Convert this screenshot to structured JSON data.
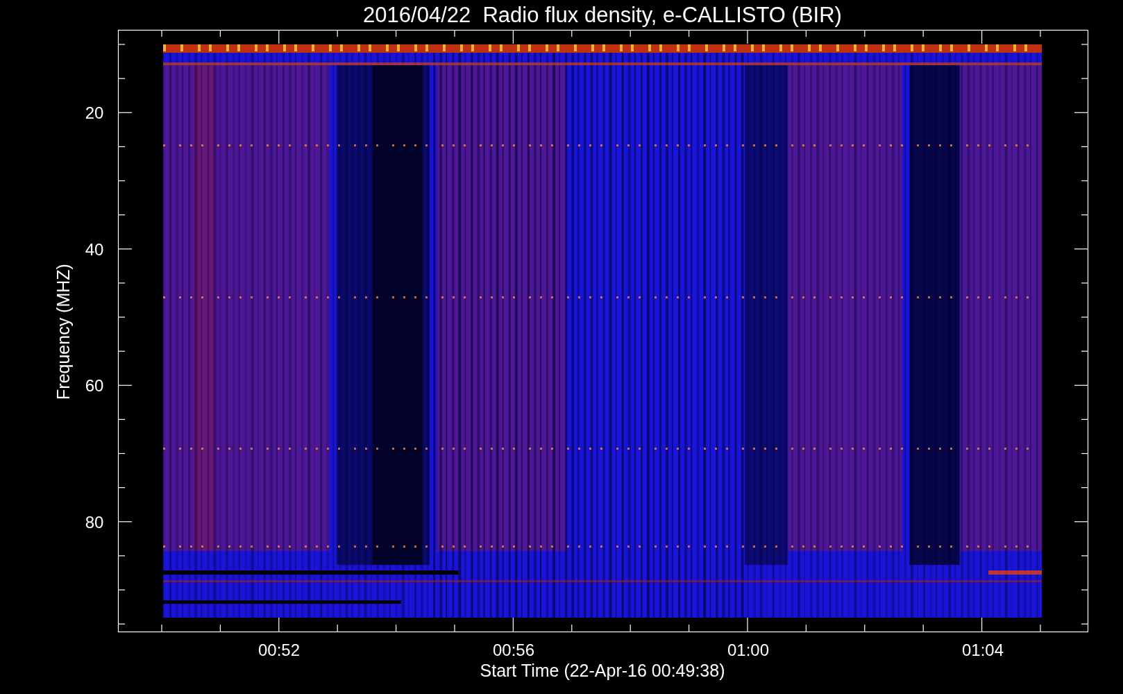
{
  "title": "2016/04/22  Radio flux density, e-CALLISTO (BIR)",
  "y_axis": {
    "label": "Frequency (MHZ)",
    "ticks": [
      "20",
      "40",
      "60",
      "80"
    ]
  },
  "x_axis": {
    "label": "Start Time (22-Apr-16 00:49:38)",
    "ticks": [
      "00:52",
      "00:56",
      "01:00",
      "01:04"
    ]
  }
}
